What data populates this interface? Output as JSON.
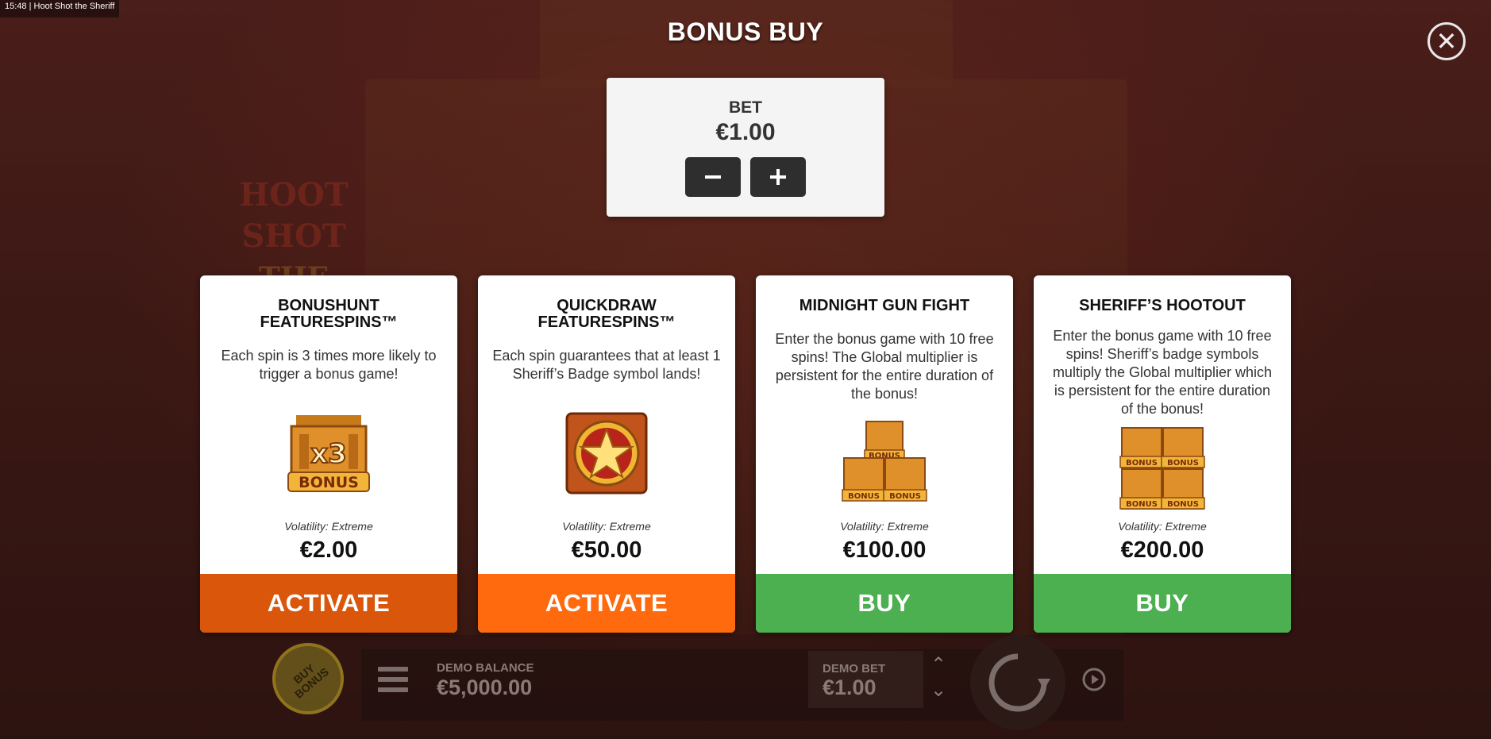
{
  "topbar": {
    "time": "15:48",
    "title": "Hoot Shot the Sheriff"
  },
  "background": {
    "logo_line1": "HOOT SHOT",
    "logo_line2": "THE SHERIFF"
  },
  "dialog": {
    "title": "BONUS BUY",
    "close_icon": "close-icon",
    "bet": {
      "label": "BET",
      "value": "€1.00",
      "decrease_icon": "minus-icon",
      "increase_icon": "plus-icon"
    }
  },
  "cards": [
    {
      "title": "BONUSHUNT\nFEATURESPINS™",
      "description": "Each spin is 3 times more likely to trigger a bonus game!",
      "image_text_top": "x3",
      "image_text_bottom": "BONUS",
      "volatility": "Volatility: Extreme",
      "price": "€2.00",
      "action": "ACTIVATE",
      "action_color": "#d9560a"
    },
    {
      "title": "QUICKDRAW\nFEATURESPINS™",
      "description": "Each spin guarantees that at least 1 Sheriff’s Badge symbol lands!",
      "volatility": "Volatility: Extreme",
      "price": "€50.00",
      "action": "ACTIVATE",
      "action_color": "#ff6a0f"
    },
    {
      "title": "MIDNIGHT GUN FIGHT",
      "description": "Enter the bonus game with 10 free spins! The Global multiplier is persistent for the entire duration of the bonus!",
      "image_text": "BONUS",
      "volatility": "Volatility: Extreme",
      "price": "€100.00",
      "action": "BUY",
      "action_color": "#4caf50"
    },
    {
      "title": "SHERIFF’S HOOTOUT",
      "description": "Enter the bonus game with 10 free spins! Sheriff’s badge symbols multiply the Global multiplier which is persistent for the entire duration of the bonus!",
      "image_text": "BONUS",
      "volatility": "Volatility: Extreme",
      "price": "€200.00",
      "action": "BUY",
      "action_color": "#4caf50"
    }
  ],
  "bottom": {
    "buy_bonus_label": "BUY BONUS",
    "demo_balance_label": "DEMO BALANCE",
    "demo_balance_value": "€5,000.00",
    "demo_bet_label": "DEMO BET",
    "demo_bet_value": "€1.00"
  }
}
